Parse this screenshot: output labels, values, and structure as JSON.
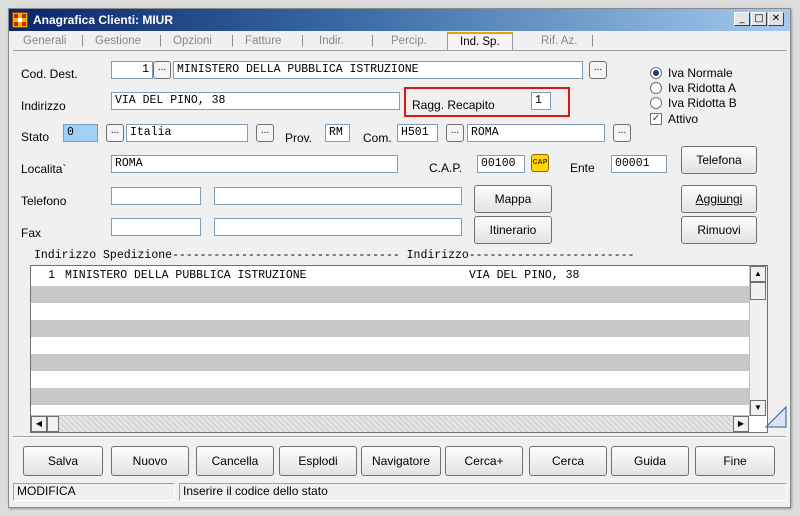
{
  "window": {
    "title": "Anagrafica Clienti: MIUR"
  },
  "tabs": [
    "Generali",
    "Gestione",
    "Opzioni",
    "Fatture",
    "Indir.",
    "Percip.",
    "Ind. Sp.",
    "Rif. Az."
  ],
  "form": {
    "cod_dest_label": "Cod. Dest.",
    "cod_dest_value": "1",
    "cod_dest_name": "MINISTERO DELLA PUBBLICA ISTRUZIONE",
    "indirizzo_label": "Indirizzo",
    "indirizzo_value": "VIA DEL PINO, 38",
    "ragg_label": "Ragg. Recapito",
    "ragg_value": "1",
    "stato_label": "Stato",
    "stato_code": "0",
    "stato_name": "Italia",
    "prov_label": "Prov.",
    "prov_value": "RM",
    "com_label": "Com.",
    "com_code": "H501",
    "com_name": "ROMA",
    "localita_label": "Localita`",
    "localita_value": "ROMA",
    "cap_label": "C.A.P.",
    "cap_value": "00100",
    "cap_icon_text": "CAP",
    "ente_label": "Ente",
    "ente_value": "00001",
    "telefono_label": "Telefono",
    "fax_label": "Fax"
  },
  "options": {
    "iva_normale": "Iva Normale",
    "iva_ridotta_a": "Iva Ridotta A",
    "iva_ridotta_b": "Iva Ridotta B",
    "attivo": "Attivo",
    "selected": "iva_normale",
    "attivo_checked": true
  },
  "side_buttons": {
    "telefona": "Telefona",
    "mappa": "Mappa",
    "itinerario": "Itinerario",
    "aggiungi": "Aggiungi",
    "rimuovi": "Rimuovi"
  },
  "list": {
    "header": "Indirizzo Spedizione--------------------------------- Indirizzo------------------------",
    "rows": [
      {
        "num": "1",
        "name": "MINISTERO DELLA PUBBLICA ISTRUZIONE",
        "address": "VIA DEL PINO, 38"
      }
    ]
  },
  "bottom_buttons": [
    "Salva",
    "Nuovo",
    "Cancella",
    "Esplodi",
    "Navigatore",
    "Cerca+",
    "Cerca",
    "Guida",
    "Fine"
  ],
  "status": {
    "mode": "MODIFICA",
    "hint": "Inserire il codice dello stato"
  }
}
